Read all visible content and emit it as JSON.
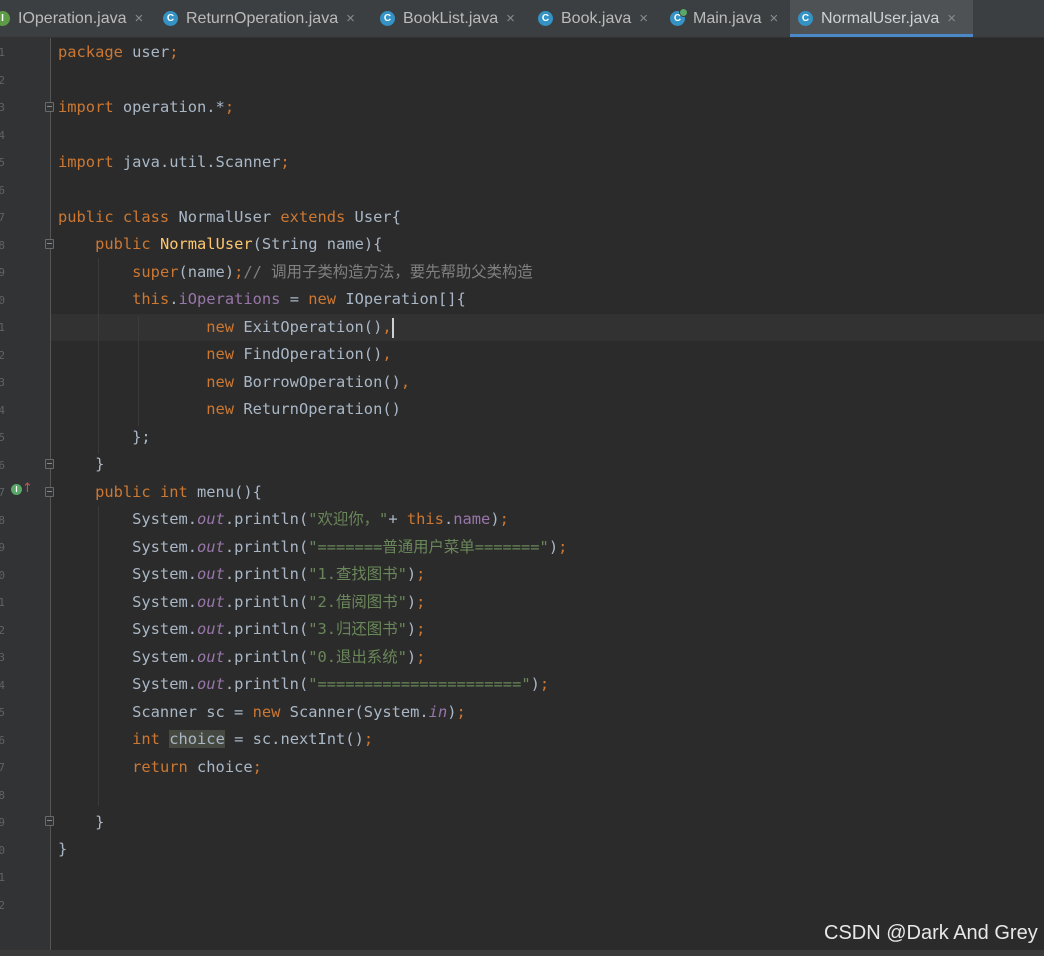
{
  "tabs": [
    {
      "label": "IOperation.java",
      "icon": "interface-icon",
      "close": "×",
      "active": false
    },
    {
      "label": "ReturnOperation.java",
      "icon": "class-icon",
      "close": "×",
      "active": false
    },
    {
      "label": "BookList.java",
      "icon": "class-icon",
      "close": "×",
      "active": false
    },
    {
      "label": "Book.java",
      "icon": "class-icon",
      "close": "×",
      "active": false
    },
    {
      "label": "Main.java",
      "icon": "runnable-class-icon",
      "close": "×",
      "active": false
    },
    {
      "label": "NormalUser.java",
      "icon": "class-icon",
      "close": "×",
      "active": true
    }
  ],
  "colors": {
    "background": "#2b2b2b",
    "keyword": "#cc7832",
    "text": "#a9b7c6",
    "field": "#9876aa",
    "method_decl": "#ffc66d",
    "comment": "#808080",
    "string": "#6a8759",
    "tab_accent": "#4a88c7"
  },
  "code": {
    "line01": [
      {
        "t": "package",
        "c": "kw"
      },
      {
        "t": " user",
        "c": "tx"
      },
      {
        "t": ";",
        "c": "kw"
      }
    ],
    "line03": [
      {
        "t": "import",
        "c": "kw"
      },
      {
        "t": " operation.*",
        "c": "tx"
      },
      {
        "t": ";",
        "c": "kw"
      }
    ],
    "line05": [
      {
        "t": "import",
        "c": "kw"
      },
      {
        "t": " java.util.Scanner",
        "c": "tx"
      },
      {
        "t": ";",
        "c": "kw"
      }
    ],
    "line07": [
      {
        "t": "public class",
        "c": "kw"
      },
      {
        "t": " NormalUser ",
        "c": "tx"
      },
      {
        "t": "extends",
        "c": "kw"
      },
      {
        "t": " User{",
        "c": "tx"
      }
    ],
    "line08": [
      {
        "t": "    "
      },
      {
        "t": "public",
        "c": "kw"
      },
      {
        "t": " "
      },
      {
        "t": "NormalUser",
        "c": "fn"
      },
      {
        "t": "(String name){",
        "c": "tx"
      }
    ],
    "line09": [
      {
        "t": "        "
      },
      {
        "t": "super",
        "c": "kw"
      },
      {
        "t": "(name)",
        "c": "tx"
      },
      {
        "t": ";",
        "c": "kw"
      },
      {
        "t": "// 调用子类构造方法，要先帮助父类构造",
        "c": "cm"
      }
    ],
    "line10": [
      {
        "t": "        "
      },
      {
        "t": "this",
        "c": "kw"
      },
      {
        "t": ".",
        "c": "tx"
      },
      {
        "t": "iOperations",
        "c": "fd"
      },
      {
        "t": " = ",
        "c": "tx"
      },
      {
        "t": "new",
        "c": "kw"
      },
      {
        "t": " IOperation[]{",
        "c": "tx"
      }
    ],
    "line11": [
      {
        "t": "                "
      },
      {
        "t": "new",
        "c": "kw"
      },
      {
        "t": " ExitOperation()",
        "c": "tx"
      },
      {
        "t": ",",
        "c": "kw"
      }
    ],
    "line12": [
      {
        "t": "                "
      },
      {
        "t": "new",
        "c": "kw"
      },
      {
        "t": " FindOperation()",
        "c": "tx"
      },
      {
        "t": ",",
        "c": "kw"
      }
    ],
    "line13": [
      {
        "t": "                "
      },
      {
        "t": "new",
        "c": "kw"
      },
      {
        "t": " BorrowOperation()",
        "c": "tx"
      },
      {
        "t": ",",
        "c": "kw"
      }
    ],
    "line14": [
      {
        "t": "                "
      },
      {
        "t": "new",
        "c": "kw"
      },
      {
        "t": " ReturnOperation()",
        "c": "tx"
      }
    ],
    "line15": [
      {
        "t": "        };",
        "c": "tx"
      }
    ],
    "line16": [
      {
        "t": "    }",
        "c": "tx"
      }
    ],
    "line17": [
      {
        "t": "    "
      },
      {
        "t": "public int",
        "c": "kw"
      },
      {
        "t": " menu(){",
        "c": "tx"
      }
    ],
    "line18": [
      {
        "t": "        System.",
        "c": "tx"
      },
      {
        "t": "out",
        "c": "it"
      },
      {
        "t": ".println(",
        "c": "tx"
      },
      {
        "t": "\"欢迎你，\"",
        "c": "st"
      },
      {
        "t": "+ ",
        "c": "tx"
      },
      {
        "t": "this",
        "c": "kw"
      },
      {
        "t": ".",
        "c": "tx"
      },
      {
        "t": "name",
        "c": "fd"
      },
      {
        "t": ")",
        "c": "tx"
      },
      {
        "t": ";",
        "c": "kw"
      }
    ],
    "line19": [
      {
        "t": "        System.",
        "c": "tx"
      },
      {
        "t": "out",
        "c": "it"
      },
      {
        "t": ".println(",
        "c": "tx"
      },
      {
        "t": "\"=======普通用户菜单=======\"",
        "c": "st"
      },
      {
        "t": ")",
        "c": "tx"
      },
      {
        "t": ";",
        "c": "kw"
      }
    ],
    "line20": [
      {
        "t": "        System.",
        "c": "tx"
      },
      {
        "t": "out",
        "c": "it"
      },
      {
        "t": ".println(",
        "c": "tx"
      },
      {
        "t": "\"1.查找图书\"",
        "c": "st"
      },
      {
        "t": ")",
        "c": "tx"
      },
      {
        "t": ";",
        "c": "kw"
      }
    ],
    "line21": [
      {
        "t": "        System.",
        "c": "tx"
      },
      {
        "t": "out",
        "c": "it"
      },
      {
        "t": ".println(",
        "c": "tx"
      },
      {
        "t": "\"2.借阅图书\"",
        "c": "st"
      },
      {
        "t": ")",
        "c": "tx"
      },
      {
        "t": ";",
        "c": "kw"
      }
    ],
    "line22": [
      {
        "t": "        System.",
        "c": "tx"
      },
      {
        "t": "out",
        "c": "it"
      },
      {
        "t": ".println(",
        "c": "tx"
      },
      {
        "t": "\"3.归还图书\"",
        "c": "st"
      },
      {
        "t": ")",
        "c": "tx"
      },
      {
        "t": ";",
        "c": "kw"
      }
    ],
    "line23": [
      {
        "t": "        System.",
        "c": "tx"
      },
      {
        "t": "out",
        "c": "it"
      },
      {
        "t": ".println(",
        "c": "tx"
      },
      {
        "t": "\"0.退出系统\"",
        "c": "st"
      },
      {
        "t": ")",
        "c": "tx"
      },
      {
        "t": ";",
        "c": "kw"
      }
    ],
    "line24": [
      {
        "t": "        System.",
        "c": "tx"
      },
      {
        "t": "out",
        "c": "it"
      },
      {
        "t": ".println(",
        "c": "tx"
      },
      {
        "t": "\"======================\"",
        "c": "st"
      },
      {
        "t": ")",
        "c": "tx"
      },
      {
        "t": ";",
        "c": "kw"
      }
    ],
    "line25": [
      {
        "t": "        Scanner sc = ",
        "c": "tx"
      },
      {
        "t": "new",
        "c": "kw"
      },
      {
        "t": " Scanner(System.",
        "c": "tx"
      },
      {
        "t": "in",
        "c": "it"
      },
      {
        "t": ")",
        "c": "tx"
      },
      {
        "t": ";",
        "c": "kw"
      }
    ],
    "line26": [
      {
        "t": "        "
      },
      {
        "t": "int",
        "c": "kw"
      },
      {
        "t": " "
      },
      {
        "t": "choice",
        "c": "hl"
      },
      {
        "t": " = sc.nextInt()",
        "c": "tx"
      },
      {
        "t": ";",
        "c": "kw"
      }
    ],
    "line27": [
      {
        "t": "        "
      },
      {
        "t": "return",
        "c": "kw"
      },
      {
        "t": " choice",
        "c": "tx"
      },
      {
        "t": ";",
        "c": "kw"
      }
    ],
    "line29": [
      {
        "t": "    }",
        "c": "tx"
      }
    ],
    "line30": [
      {
        "t": "}",
        "c": "tx"
      }
    ]
  },
  "gutter": {
    "numbers": [
      "1",
      "2",
      "3",
      "4",
      "5",
      "6",
      "7",
      "8",
      "9",
      "0",
      "1",
      "2",
      "3",
      "4",
      "5",
      "6",
      "7",
      "8",
      "9",
      "0",
      "1",
      "2",
      "3",
      "4",
      "5",
      "6",
      "7",
      "8",
      "9",
      "0",
      "1",
      "2"
    ],
    "override_icon": "implements-method-icon"
  },
  "watermark": "CSDN @Dark And Grey"
}
